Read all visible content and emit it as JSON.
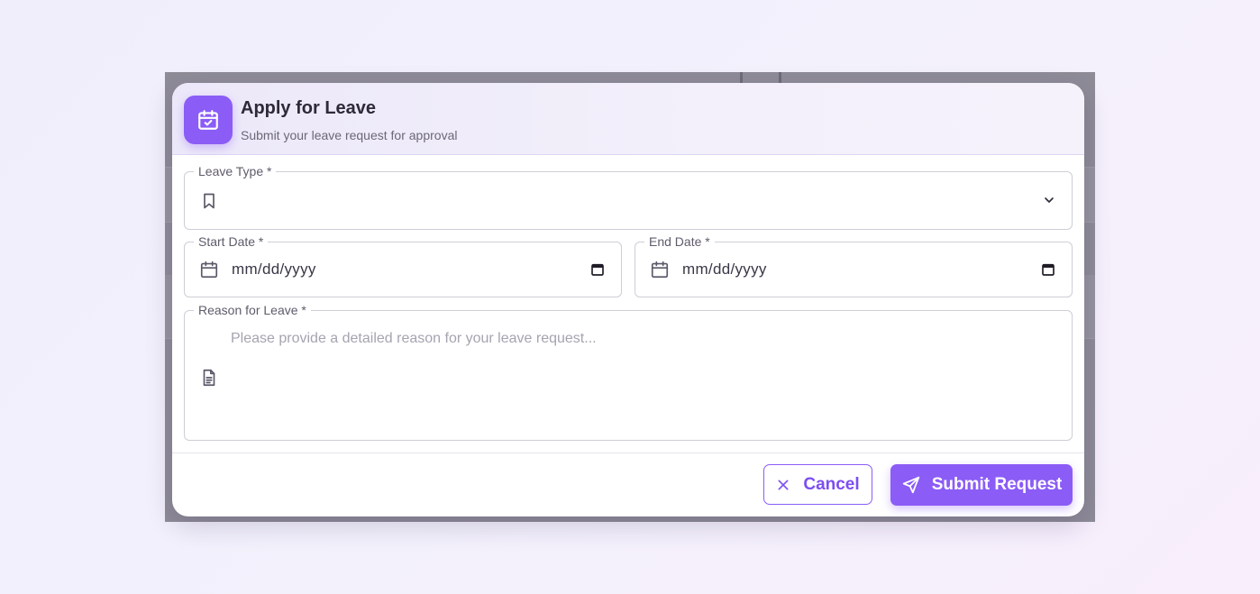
{
  "modal": {
    "title": "Apply for Leave",
    "subtitle": "Submit your leave request for approval",
    "header_icon": "calendar-check-icon",
    "accent_color": "#8b5cf6"
  },
  "form": {
    "leave_type": {
      "label": "Leave Type *",
      "value": "",
      "icon": "bookmark-icon",
      "dropdown_icon": "chevron-down-icon"
    },
    "start_date": {
      "label": "Start Date *",
      "value": "mm/dd/yyyy",
      "icon": "calendar-icon",
      "picker_icon": "calendar-picker-icon"
    },
    "end_date": {
      "label": "End Date *",
      "value": "mm/dd/yyyy",
      "icon": "calendar-icon",
      "picker_icon": "calendar-picker-icon"
    },
    "reason": {
      "label": "Reason for Leave *",
      "placeholder": "Please provide a detailed reason for your leave request...",
      "icon": "document-icon"
    }
  },
  "footer": {
    "cancel_label": "Cancel",
    "cancel_icon": "close-icon",
    "submit_label": "Submit Request",
    "submit_icon": "send-icon"
  }
}
